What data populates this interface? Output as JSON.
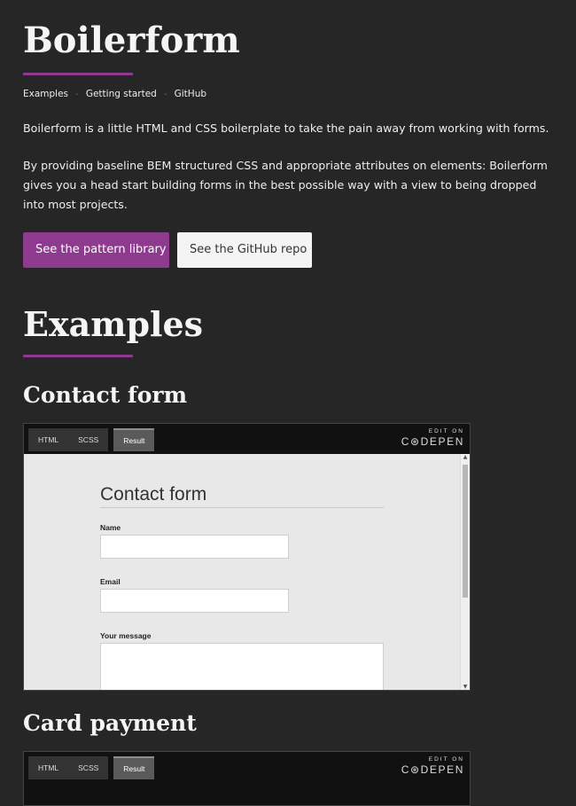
{
  "site": {
    "title": "Boilerform"
  },
  "nav": {
    "items": [
      "Examples",
      "Getting started",
      "GitHub"
    ],
    "separator": "-"
  },
  "intro": {
    "p1": "Boilerform is a little HTML and CSS boilerplate to take the pain away from working with forms.",
    "p2": "By providing baseline BEM structured CSS and appropriate attributes on elements: Boilerform gives you a head start building forms in the best possible way with a view to being dropped into most projects."
  },
  "buttons": {
    "pattern_library": "See the pattern library",
    "github_repo": "See the GitHub repo"
  },
  "examples": {
    "heading": "Examples",
    "contact": {
      "heading": "Contact form"
    },
    "card": {
      "heading": "Card payment"
    }
  },
  "codepen": {
    "tabs": [
      "HTML",
      "SCSS",
      "Result"
    ],
    "active_tab": "Result",
    "edit_label": "EDIT ON",
    "brand": "C⊛DEPEN"
  },
  "contact_form": {
    "title": "Contact form",
    "name_label": "Name",
    "email_label": "Email",
    "message_label": "Your message"
  },
  "colors": {
    "accent": "#8e3a8f",
    "background": "#262626",
    "separator": "#b8423f"
  }
}
